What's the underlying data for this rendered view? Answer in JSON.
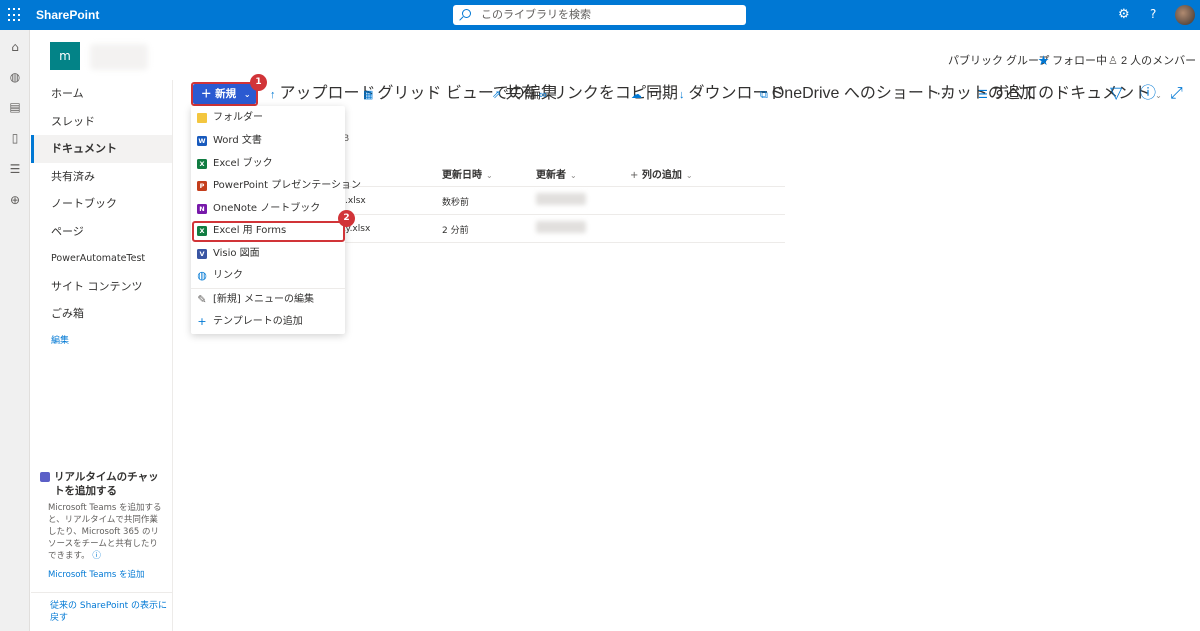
{
  "topbar": {
    "app_name": "SharePoint",
    "search_placeholder": "このライブラリを検索",
    "help_label": "?"
  },
  "site_header": {
    "logo_letter": "m",
    "group_type": "パブリック グループ",
    "follow_label": "フォロー中",
    "members_label": "2 人のメンバー"
  },
  "nav": {
    "items": [
      {
        "label": "ホーム"
      },
      {
        "label": "スレッド"
      },
      {
        "label": "ドキュメント"
      },
      {
        "label": "共有済み"
      },
      {
        "label": "ノートブック"
      },
      {
        "label": "ページ"
      },
      {
        "label": "PowerAutomateTest"
      },
      {
        "label": "サイト コンテンツ"
      },
      {
        "label": "ごみ箱"
      }
    ],
    "edit_label": "編集"
  },
  "teams_promo": {
    "title": "リアルタイムのチャットを追加する",
    "body": "Microsoft Teams を追加すると、リアルタイムで共同作業したり、Microsoft 365 のリソースをチームと共有したりできます。",
    "info_icon": "ⓘ",
    "link": "Microsoft Teams を追加"
  },
  "classic_link": "従来の SharePoint の表示に戻す",
  "commands": {
    "new_label": "新規",
    "upload": "アップロード",
    "grid_edit": "グリッド ビューでの編集",
    "share": "共有",
    "copy_link": "リンクをコピー",
    "sync": "同期",
    "download": "ダウンロード",
    "onedrive_shortcut": "OneDrive へのショートカットの追加",
    "more": "···",
    "view_selector": "すべてのドキュメント"
  },
  "badges": {
    "first": "1",
    "second": "2"
  },
  "table": {
    "partial_header": "B",
    "columns": [
      "更新日時",
      "更新者",
      "列の追加"
    ],
    "add_col_prefix": "+",
    "rows": [
      {
        "name": ".xlsx",
        "modified": "数秒前"
      },
      {
        "name": "ty.xlsx",
        "modified": "2 分前"
      }
    ]
  },
  "new_menu": {
    "items": [
      {
        "label": "フォルダー",
        "icon": "folder-icon"
      },
      {
        "label": "Word 文書",
        "icon": "word-icon"
      },
      {
        "label": "Excel ブック",
        "icon": "excel-icon"
      },
      {
        "label": "PowerPoint プレゼンテーション",
        "icon": "powerpoint-icon"
      },
      {
        "label": "OneNote ノートブック",
        "icon": "onenote-icon"
      },
      {
        "label": "Excel 用 Forms",
        "icon": "forms-excel-icon"
      },
      {
        "label": "Visio 図面",
        "icon": "visio-icon"
      },
      {
        "label": "リンク",
        "icon": "globe-icon"
      },
      {
        "label": "[新規] メニューの編集",
        "icon": "pencil-icon"
      },
      {
        "label": "テンプレートの追加",
        "icon": "plus-icon"
      }
    ]
  },
  "colors": {
    "brand": "#0078d4",
    "highlight": "#d13438",
    "new_button": "#2b5ad1"
  }
}
